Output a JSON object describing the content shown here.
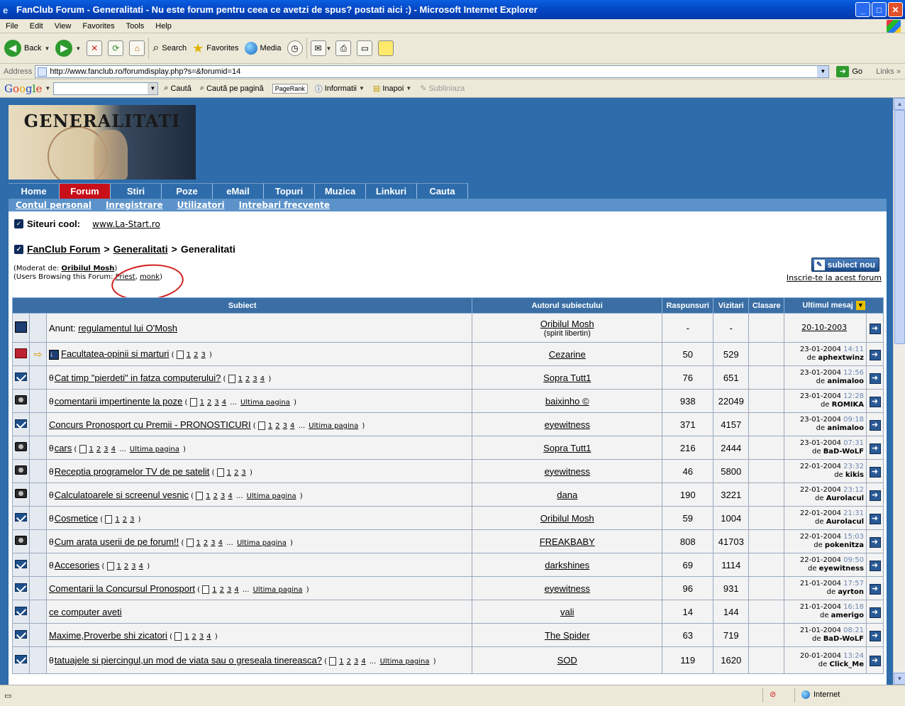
{
  "window": {
    "title": "FanClub Forum - Generalitati - Nu este forum pentru ceea ce avetzi de spus? postati aici :) - Microsoft Internet Explorer"
  },
  "menu": [
    "File",
    "Edit",
    "View",
    "Favorites",
    "Tools",
    "Help"
  ],
  "toolbar": {
    "back": "Back",
    "search": "Search",
    "favorites": "Favorites",
    "media": "Media"
  },
  "address": {
    "label": "Address",
    "url": "http://www.fanclub.ro/forumdisplay.php?s=&forumid=14",
    "go": "Go",
    "links": "Links"
  },
  "google": {
    "search_btn": "Caută",
    "search_page": "Caută pe pagină",
    "pagerank": "PageRank",
    "info": "Informatii",
    "back": "Inapoi",
    "highlight": "Subliniaza"
  },
  "banner": {
    "text": "GENERALITATI"
  },
  "nav_tabs": [
    "Home",
    "Forum",
    "Stiri",
    "Poze",
    "eMail",
    "Topuri",
    "Muzica",
    "Linkuri",
    "Cauta"
  ],
  "sub_nav": [
    "Contul personal",
    "Inregistrare",
    "Utilizatori",
    "Intrebari frecvente"
  ],
  "cool_sites": {
    "label": "Siteuri cool:",
    "link": "www.La-Start.ro"
  },
  "breadcrumb": {
    "root": "FanClub Forum",
    "parent": "Generalitati",
    "current": "Generalitati"
  },
  "moderator": {
    "prefix": "(Moderat de: ",
    "name": "Oribilul Mosh",
    "suffix": ")",
    "browsing_prefix": "(Users Browsing this Forum: ",
    "user1": "Priest",
    "user2": "monk",
    "browsing_suffix": ")"
  },
  "new_thread": "subiect nou",
  "subscribe": "Inscrie-te la acest forum",
  "table": {
    "headers": {
      "subject": "Subiect",
      "author": "Autorul subiectului",
      "replies": "Raspunsuri",
      "views": "Vizitari",
      "rating": "Clasare",
      "last": "Ultimul mesaj"
    },
    "announcement": {
      "prefix": "Anunt:",
      "title": "regulamentul lui O'Mosh",
      "author": "Oribilul Mosh",
      "author_sub": "(spirit libertin)",
      "replies": "-",
      "views": "-",
      "date": "20-10-2003"
    },
    "rows": [
      {
        "title": "Facultatea-opinii si marturi",
        "pages": "1 2 3",
        "extra": "",
        "author": "Cezarine",
        "replies": "50",
        "views": "529",
        "date": "23-01-2004",
        "time": "14:11",
        "by": "aphextwinz"
      },
      {
        "title": "Cat timp \"pierdeti\" in fatza computerului?",
        "pages": "1 2 3 4",
        "extra": "",
        "author": "Sopra Tutt1",
        "replies": "76",
        "views": "651",
        "date": "23-01-2004",
        "time": "12:56",
        "by": "animaloo"
      },
      {
        "title": "comentarii impertinente la poze",
        "pages": "1 2 3 4 ...",
        "extra": "Ultima pagina",
        "author": "baixinho ©",
        "replies": "938",
        "views": "22049",
        "date": "23-01-2004",
        "time": "12:28",
        "by": "ROMIKA"
      },
      {
        "title": "Concurs Pronosport cu Premii - PRONOSTICURI",
        "pages": "1 2 3 4 ...",
        "extra": "Ultima pagina",
        "author": "eyewitness",
        "replies": "371",
        "views": "4157",
        "date": "23-01-2004",
        "time": "09:18",
        "by": "animaloo"
      },
      {
        "title": "cars",
        "pages": "1 2 3 4 ...",
        "extra": "Ultima pagina",
        "author": "Sopra Tutt1",
        "replies": "216",
        "views": "2444",
        "date": "23-01-2004",
        "time": "07:31",
        "by": "BaD-WoLF"
      },
      {
        "title": "Receptia programelor TV de pe satelit",
        "pages": "1 2 3",
        "extra": "",
        "author": "eyewitness",
        "replies": "46",
        "views": "5800",
        "date": "22-01-2004",
        "time": "23:32",
        "by": "kikis"
      },
      {
        "title": "Calculatoarele si screenul vesnic",
        "pages": "1 2 3 4 ...",
        "extra": "Ultima pagina",
        "author": "dana",
        "replies": "190",
        "views": "3221",
        "date": "22-01-2004",
        "time": "23:12",
        "by": "Aurolacul"
      },
      {
        "title": "Cosmetice",
        "pages": "1 2 3",
        "extra": "",
        "author": "Oribilul Mosh",
        "replies": "59",
        "views": "1004",
        "date": "22-01-2004",
        "time": "21:31",
        "by": "Aurolacul"
      },
      {
        "title": "Cum arata userii de pe forum!!",
        "pages": "1 2 3 4 ...",
        "extra": "Ultima pagina",
        "author": "FREAKBABY",
        "replies": "808",
        "views": "41703",
        "date": "22-01-2004",
        "time": "15:03",
        "by": "pokenitza"
      },
      {
        "title": "Accesories",
        "pages": "1 2 3 4",
        "extra": "",
        "author": "darkshines",
        "replies": "69",
        "views": "1114",
        "date": "22-01-2004",
        "time": "09:50",
        "by": "eyewitness"
      },
      {
        "title": "Comentarii la Concursul Pronosport",
        "pages": "1 2 3 4 ...",
        "extra": "Ultima pagina",
        "author": "eyewitness",
        "replies": "96",
        "views": "931",
        "date": "21-01-2004",
        "time": "17:57",
        "by": "ayrton"
      },
      {
        "title": "ce computer aveti",
        "pages": "",
        "extra": "",
        "author": "vali",
        "replies": "14",
        "views": "144",
        "date": "21-01-2004",
        "time": "16:18",
        "by": "amerigo"
      },
      {
        "title": "Maxime,Proverbe shi zicatori",
        "pages": "1 2 3 4",
        "extra": "",
        "author": "The Spider",
        "replies": "63",
        "views": "719",
        "date": "21-01-2004",
        "time": "08:21",
        "by": "BaD-WoLF"
      },
      {
        "title": "tatuajele si piercingul,un mod de viata sau o greseala tinereasca?",
        "pages": "1 2 3 4 ...",
        "extra": "Ultima pagina",
        "author": "SOD",
        "replies": "119",
        "views": "1620",
        "date": "20-01-2004",
        "time": "13:24",
        "by": "Click_Me"
      }
    ],
    "by_prefix": "de"
  },
  "statusbar": {
    "zone": "Internet"
  }
}
